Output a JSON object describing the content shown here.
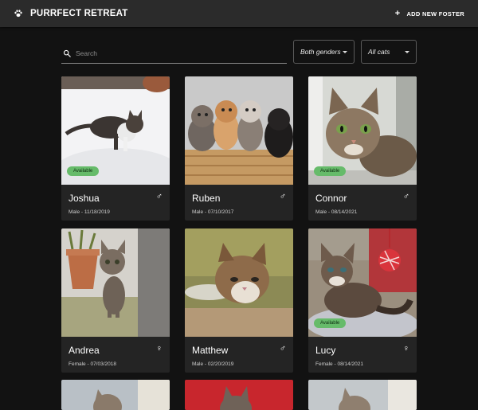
{
  "app": {
    "title": "PURRFECT RETREAT",
    "logo_icon": "paw-icon"
  },
  "toolbar": {
    "add_label": "ADD NEW FOSTER"
  },
  "search": {
    "placeholder": "Search",
    "value": ""
  },
  "filters": {
    "gender": "Both genders",
    "category": "All cats"
  },
  "cats": [
    {
      "name": "Joshua",
      "meta": "Male - 11/18/2019",
      "sex_icon": "male-icon",
      "sex_symbol": "♂",
      "badge": "Available"
    },
    {
      "name": "Ruben",
      "meta": "Male - 07/10/2017",
      "sex_icon": "male-icon",
      "sex_symbol": "♂",
      "badge": ""
    },
    {
      "name": "Connor",
      "meta": "Male - 08/14/2021",
      "sex_icon": "male-icon",
      "sex_symbol": "♂",
      "badge": "Available"
    },
    {
      "name": "Andrea",
      "meta": "Female - 07/03/2018",
      "sex_icon": "female-icon",
      "sex_symbol": "♀",
      "badge": ""
    },
    {
      "name": "Matthew",
      "meta": "Male - 02/20/2019",
      "sex_icon": "male-icon",
      "sex_symbol": "♂",
      "badge": ""
    },
    {
      "name": "Lucy",
      "meta": "Female - 08/14/2021",
      "sex_icon": "female-icon",
      "sex_symbol": "♀",
      "badge": "Available"
    }
  ]
}
